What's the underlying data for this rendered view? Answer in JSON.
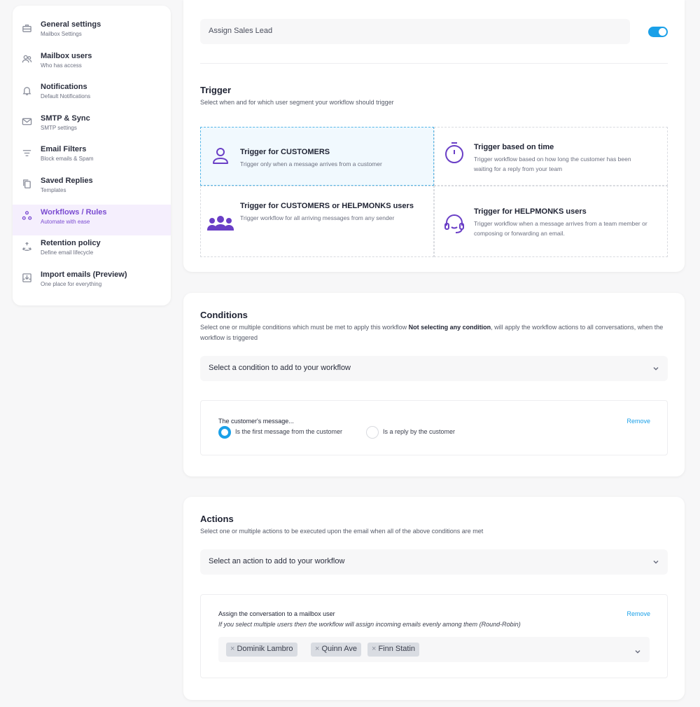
{
  "sidebar": {
    "items": [
      {
        "title": "General settings",
        "subtitle": "Mailbox Settings",
        "icon": "briefcase-icon"
      },
      {
        "title": "Mailbox users",
        "subtitle": "Who has access",
        "icon": "users-icon"
      },
      {
        "title": "Notifications",
        "subtitle": "Default Notifications",
        "icon": "bell-icon"
      },
      {
        "title": "SMTP & Sync",
        "subtitle": "SMTP settings",
        "icon": "mail-icon"
      },
      {
        "title": "Email Filters",
        "subtitle": "Block emails & Spam",
        "icon": "filter-icon"
      },
      {
        "title": "Saved Replies",
        "subtitle": "Templates",
        "icon": "copy-icon"
      },
      {
        "title": "Workflows / Rules",
        "subtitle": "Automate with ease",
        "icon": "workflow-icon"
      },
      {
        "title": "Retention policy",
        "subtitle": "Define email lifecycle",
        "icon": "recycle-icon"
      },
      {
        "title": "Import emails (Preview)",
        "subtitle": "One place for everything",
        "icon": "import-icon"
      }
    ],
    "active_index": 6
  },
  "workflow": {
    "name": "Assign Sales Lead",
    "enabled": true
  },
  "trigger": {
    "title": "Trigger",
    "subtitle": "Select when and for which user segment your workflow should trigger",
    "options": [
      {
        "title": "Trigger for CUSTOMERS",
        "desc": "Trigger only when a message arrives from a customer",
        "icon": "user-icon",
        "selected": true
      },
      {
        "title": "Trigger based on time",
        "desc": "Trigger workflow based on how long the customer has been waiting for a reply from your team",
        "icon": "stopwatch-icon",
        "selected": false
      },
      {
        "title": "Trigger for CUSTOMERS or HELPMONKS users",
        "desc": "Trigger workflow for all arriving messages from any sender",
        "icon": "group-icon",
        "selected": false
      },
      {
        "title": "Trigger for HELPMONKS users",
        "desc": "Trigger workflow when a message arrives from a team member or composing or forwarding an email.",
        "icon": "headset-icon",
        "selected": false
      }
    ]
  },
  "conditions": {
    "title": "Conditions",
    "subtitle_pre": "Select one or multiple conditions which must be met to apply this workflow ",
    "subtitle_bold": "Not selecting any condition",
    "subtitle_post": ", will apply the workflow actions to all conversations, when the workflow is triggered",
    "select_placeholder": "Select a condition to add to your workflow",
    "item": {
      "label": "The customer's message...",
      "remove": "Remove",
      "options": [
        "Is the first message from the customer",
        "Is a reply by the customer"
      ],
      "selected_index": 0
    }
  },
  "actions": {
    "title": "Actions",
    "subtitle": "Select one or multiple actions to be executed upon the email when all of the above conditions are met",
    "select_placeholder": "Select an action to add to your workflow",
    "item": {
      "label": "Assign the conversation to a mailbox user",
      "note": "If you select multiple users then the workflow will assign incoming emails evenly among them (Round-Robin)",
      "remove": "Remove",
      "users": [
        "Dominik Lambro",
        "Quinn Ave",
        "Finn Statin"
      ]
    }
  },
  "colors": {
    "accent": "#7a4bd1",
    "link": "#1aa0e8"
  }
}
